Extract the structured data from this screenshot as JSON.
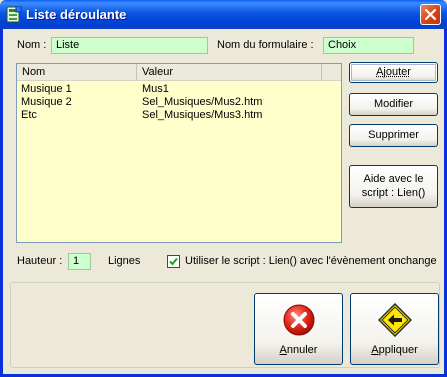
{
  "window": {
    "title": "Liste déroulante",
    "title_bar_color": "#0a55e3"
  },
  "form": {
    "nom_label": "Nom :",
    "nom_value": "Liste",
    "form_name_label": "Nom du formulaire :",
    "form_name_value": "Choix",
    "field_color": "#ccffcc"
  },
  "list": {
    "background": "#ffffcc",
    "columns": [
      "Nom",
      "Valeur"
    ],
    "rows": [
      [
        "Musique 1",
        "Mus1"
      ],
      [
        "Musique 2",
        "Sel_Musiques/Mus2.htm"
      ],
      [
        "Etc",
        "Sel_Musiques/Mus3.htm"
      ]
    ]
  },
  "side_buttons": {
    "add": "Ajouter",
    "modify": "Modifier",
    "delete": "Supprimer",
    "help_line1": "Aide avec le",
    "help_line2": "script : Lien()"
  },
  "options": {
    "height_label": "Hauteur :",
    "height_value": "1",
    "lines_label": "Lignes",
    "use_script_checked": true,
    "use_script_label": "Utiliser le script : Lien()  avec l'évènement onchange"
  },
  "actions": {
    "cancel": "Annuler",
    "cancel_icon": "cancel-x-icon",
    "apply": "Appliquer",
    "apply_icon": "arrow-left-sign-icon"
  }
}
